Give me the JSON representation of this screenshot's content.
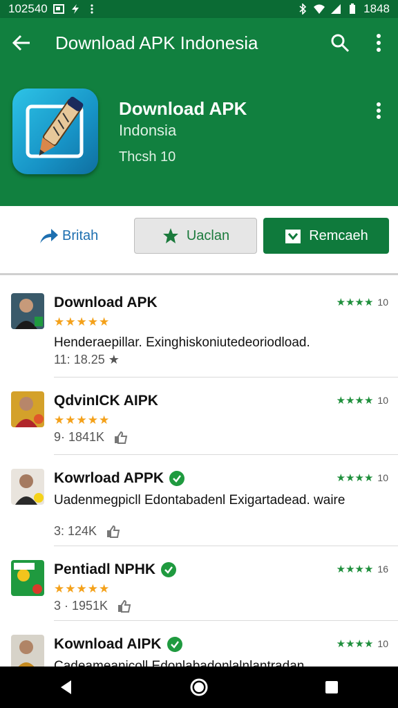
{
  "status_bar": {
    "time_left": "102540",
    "time_right": "1848"
  },
  "appbar": {
    "title": "Download APK Indonesia"
  },
  "hero": {
    "title": "Download APK",
    "subtitle": "Indonsia",
    "meta": "Thcsh 10"
  },
  "actions": {
    "share_label": "Britah",
    "wishlist_label": "Uaclan",
    "install_label": "Remcaeh"
  },
  "items": [
    {
      "title": "Download APK",
      "stars": "★★★★★",
      "rating_stars": "★★★★",
      "rating_num": "10",
      "desc": "Henderaepillar. Exinghiskoniutedeoriodload.",
      "meta": "11: 18.25 ★",
      "verified": false
    },
    {
      "title": "QdvinICK AIPK",
      "stars": "★★★★★",
      "rating_stars": "★★★★",
      "rating_num": "10",
      "desc": "",
      "meta": "9· 1841K",
      "verified": false
    },
    {
      "title": "Kowrload APPK",
      "stars": "",
      "rating_stars": "★★★★",
      "rating_num": "10",
      "desc": "Uadenmegpicll Edontabadenl Exigartadead. waire",
      "meta": "3: 124K",
      "verified": true
    },
    {
      "title": "Pentiadl NPHK",
      "stars": "★★★★★",
      "rating_stars": "★★★★",
      "rating_num": "16",
      "desc": "",
      "meta": "3 · 1951K",
      "verified": true
    },
    {
      "title": "Kownload AIPK",
      "stars": "",
      "rating_stars": "★★★★",
      "rating_num": "10",
      "desc": "Cadeameanicoll Edonlabadonlalnlantradan",
      "meta": "",
      "verified": true
    }
  ],
  "colors": {
    "appbar": "#11803f",
    "status": "#0b6b34",
    "accent": "#0f7a3c",
    "star": "#f4a11a"
  }
}
